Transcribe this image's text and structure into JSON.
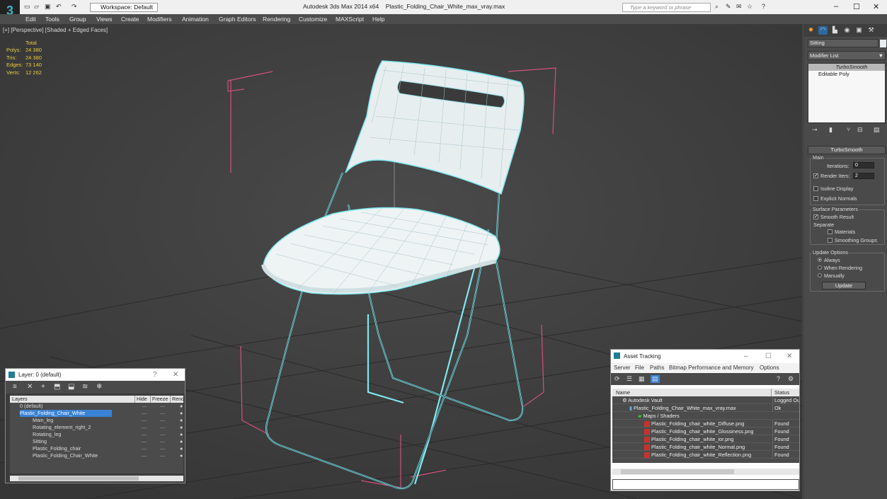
{
  "titlebar": {
    "workspace_label": "Workspace: Default",
    "app_title": "Autodesk 3ds Max 2014 x64",
    "file_name": "Plastic_Folding_Chair_White_max_vray.max",
    "search_placeholder": "Type a keyword or phrase"
  },
  "menu": [
    "Edit",
    "Tools",
    "Group",
    "Views",
    "Create",
    "Modifiers",
    "Animation",
    "Graph Editors",
    "Rendering",
    "Customize",
    "MAXScript",
    "Help"
  ],
  "viewport": {
    "label": "[+] [Perspective] [Shaded + Edged Faces]",
    "stats": {
      "header": "Total",
      "rows": [
        {
          "k": "Polys:",
          "v": "24 380"
        },
        {
          "k": "Tris:",
          "v": "24 380"
        },
        {
          "k": "Edges:",
          "v": "73 140"
        },
        {
          "k": "Verts:",
          "v": "12 262"
        }
      ]
    },
    "gizmo_axis": "z"
  },
  "command_panel": {
    "object_name": "Sitting",
    "modifier_list": "Modifier List",
    "stack": [
      "TurboSmooth",
      "Editable Poly"
    ],
    "rollout_title": "TurboSmooth",
    "main_group": "Main",
    "iterations_label": "Iterations:",
    "iterations_value": "0",
    "render_iters_label": "Render Iters:",
    "render_iters_value": "2",
    "isoline_label": "Isoline Display",
    "explicit_normals_label": "Explicit Normals",
    "surface_group": "Surface Parameters",
    "smooth_result_label": "Smooth Result",
    "separate_label": "Separate",
    "materials_label": "Materials",
    "smoothing_groups_label": "Smoothing Groups",
    "update_group": "Update Options",
    "always_label": "Always",
    "when_rendering_label": "When Rendering",
    "manually_label": "Manually",
    "update_button": "Update"
  },
  "layer_window": {
    "title": "Layer: 0 (default)",
    "help": "?",
    "close": "✕",
    "headers": {
      "layers": "Layers",
      "hide": "Hide",
      "freeze": "Freeze",
      "render": "Rend"
    },
    "rows": [
      {
        "name": "0 (default)",
        "indent": 1
      },
      {
        "name": "Plastic_Folding_Chair_White",
        "indent": 1,
        "selected": true
      },
      {
        "name": "Main_leg",
        "indent": 2
      },
      {
        "name": "Rotating_element_right_2",
        "indent": 2
      },
      {
        "name": "Rotating_leg",
        "indent": 2
      },
      {
        "name": "Sitting",
        "indent": 2
      },
      {
        "name": "Plastic_Folding_chair",
        "indent": 2
      },
      {
        "name": "Plastic_Folding_Chair_White",
        "indent": 2
      }
    ]
  },
  "asset_tracking": {
    "title": "Asset Tracking",
    "menu": [
      "Server",
      "File",
      "Paths",
      "Bitmap Performance and Memory",
      "Options"
    ],
    "headers": {
      "name": "Name",
      "status": "Status"
    },
    "rows": [
      {
        "name": "Autodesk Vault",
        "status": "Logged Out",
        "indent": 0,
        "icon": "vault"
      },
      {
        "name": "Plastic_Folding_Chair_White_max_vray.max",
        "status": "Ok",
        "indent": 1,
        "icon": "max"
      },
      {
        "name": "Maps / Shaders",
        "status": "",
        "indent": 2,
        "icon": "folder"
      },
      {
        "name": "Plastic_Folding_chair_white_Diffuse.png",
        "status": "Found",
        "indent": 3,
        "icon": "png"
      },
      {
        "name": "Plastic_Folding_chair_white_Glossiness.png",
        "status": "Found",
        "indent": 3,
        "icon": "png"
      },
      {
        "name": "Plastic_Folding_chair_white_ior.png",
        "status": "Found",
        "indent": 3,
        "icon": "png"
      },
      {
        "name": "Plastic_Folding_chair_white_Normal.png",
        "status": "Found",
        "indent": 3,
        "icon": "png"
      },
      {
        "name": "Plastic_Folding_chair_white_Reflection.png",
        "status": "Found",
        "indent": 3,
        "icon": "png"
      }
    ]
  },
  "colors": {
    "accent": "#3a82d6",
    "wire": "#7fe7ee",
    "bbox": "#d0527a",
    "stats": "#e8cc3c"
  }
}
